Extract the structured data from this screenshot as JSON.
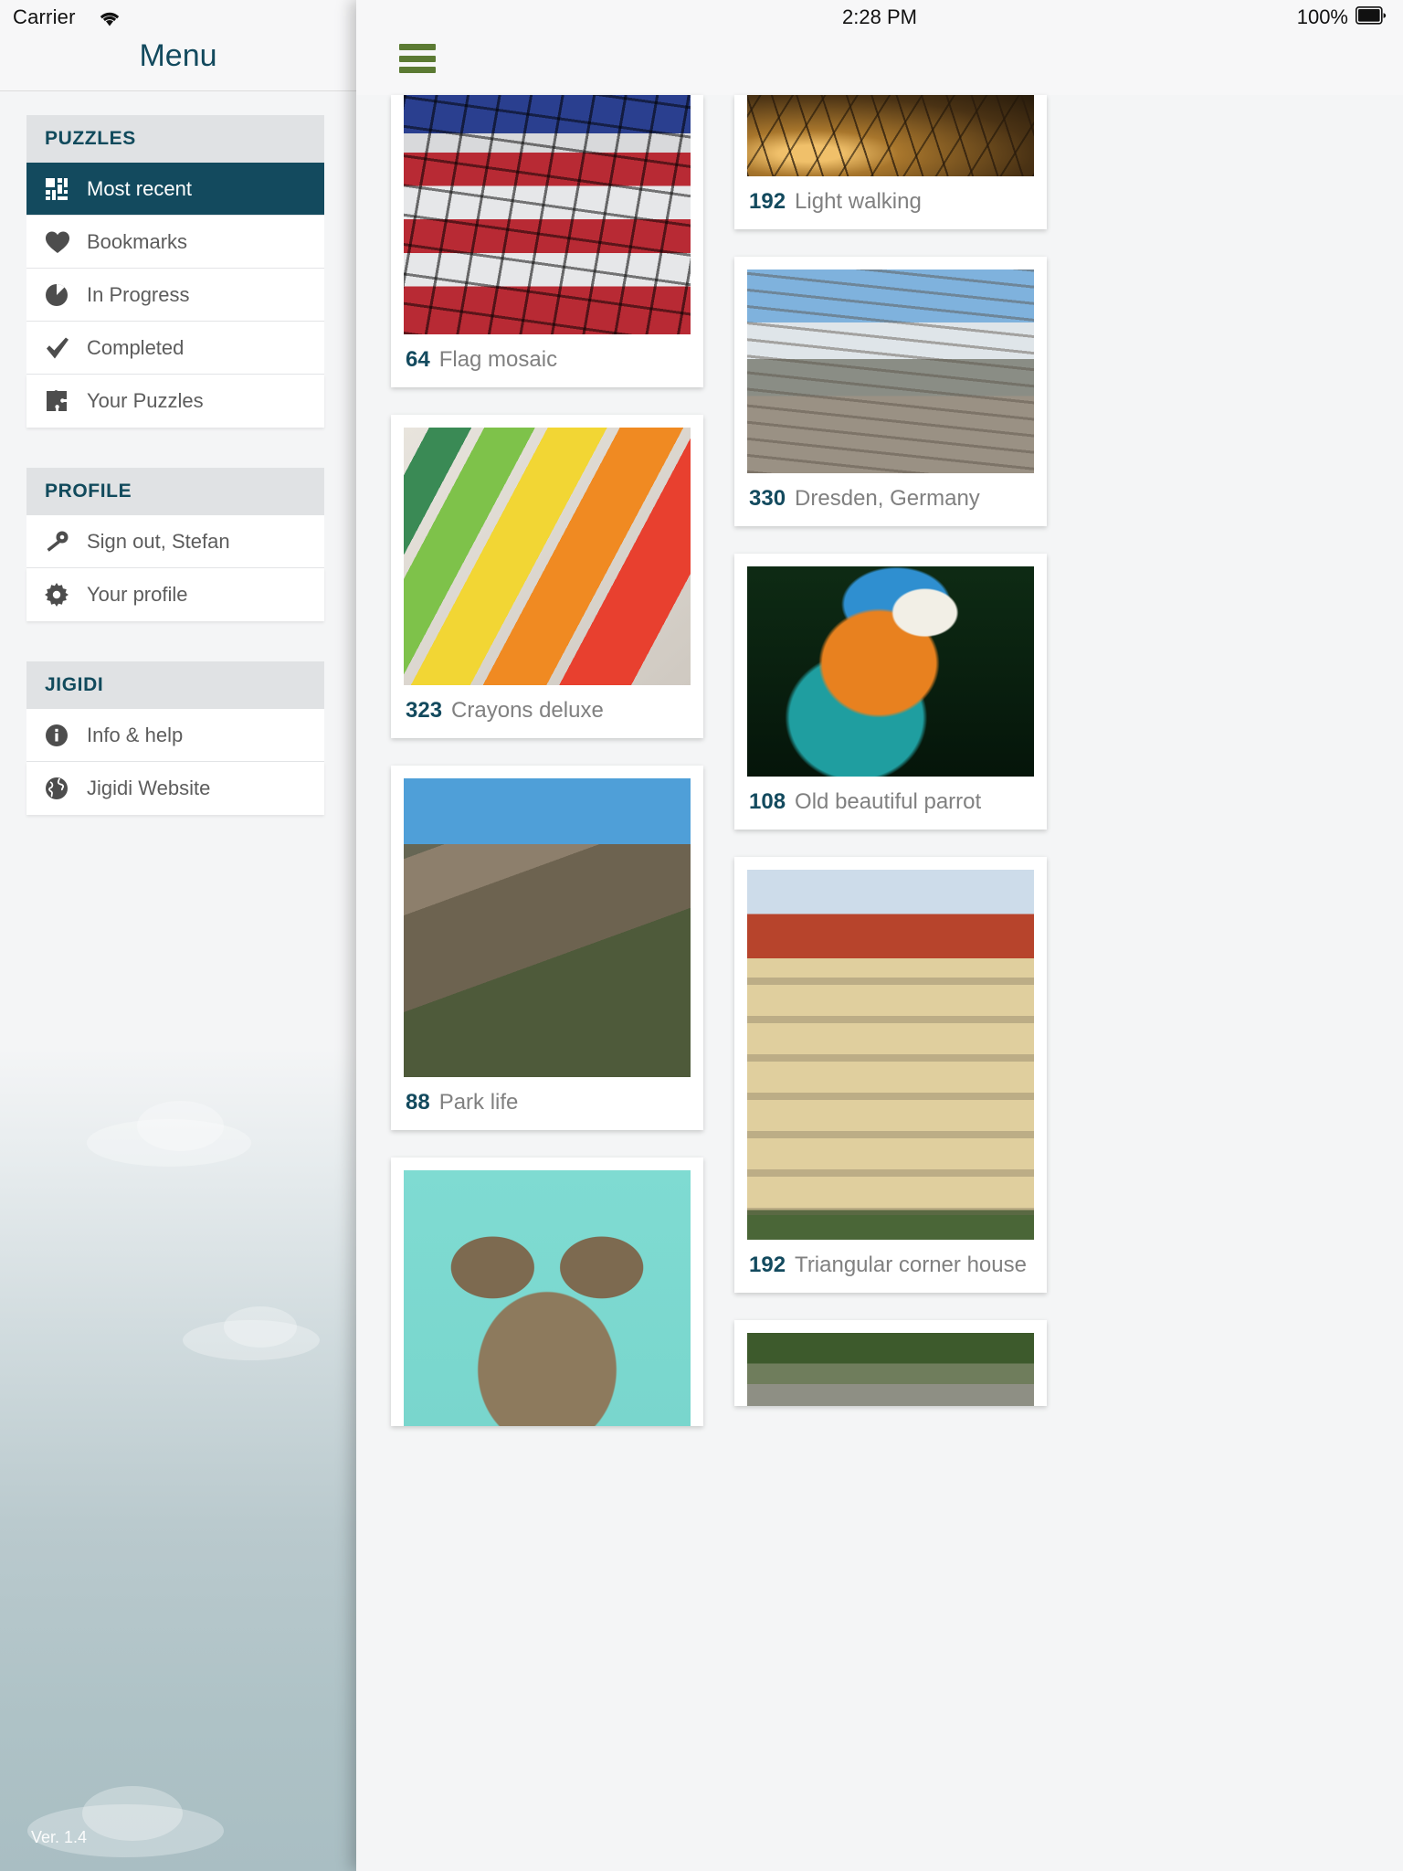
{
  "sidebar": {
    "status": {
      "carrier": "Carrier",
      "wifi_icon": "wifi-icon"
    },
    "title": "Menu",
    "version": "Ver. 1.4",
    "groups": [
      {
        "heading": "PUZZLES",
        "items": [
          {
            "label": "Most recent",
            "icon": "grid-icon",
            "active": true
          },
          {
            "label": "Bookmarks",
            "icon": "heart-icon",
            "active": false
          },
          {
            "label": "In Progress",
            "icon": "pie-icon",
            "active": false
          },
          {
            "label": "Completed",
            "icon": "check-icon",
            "active": false
          },
          {
            "label": "Your Puzzles",
            "icon": "puzzle-icon",
            "active": false
          }
        ]
      },
      {
        "heading": "PROFILE",
        "items": [
          {
            "label": "Sign out, Stefan",
            "icon": "key-icon",
            "active": false
          },
          {
            "label": "Your profile",
            "icon": "gear-icon",
            "active": false
          }
        ]
      },
      {
        "heading": "JIGIDI",
        "items": [
          {
            "label": "Info & help",
            "icon": "info-icon",
            "active": false
          },
          {
            "label": "Jigidi Website",
            "icon": "globe-icon",
            "active": false
          }
        ]
      }
    ]
  },
  "main": {
    "status": {
      "time": "2:28 PM",
      "battery_pct": "100%",
      "battery_icon": "battery-full-icon"
    },
    "menu_icon": "hamburger-icon",
    "accent_color": "#134a5e",
    "menu_icon_color": "#5b7a33",
    "cards_left": [
      {
        "pieces": "64",
        "title": "Flag mosaic",
        "clip": "top"
      },
      {
        "pieces": "323",
        "title": "Crayons deluxe",
        "clip": "none"
      },
      {
        "pieces": "88",
        "title": "Park life",
        "clip": "none"
      },
      {
        "pieces": "",
        "title": "",
        "clip": "bottom"
      }
    ],
    "cards_right": [
      {
        "pieces": "192",
        "title": "Light walking",
        "clip": "top"
      },
      {
        "pieces": "330",
        "title": "Dresden, Germany",
        "clip": "none"
      },
      {
        "pieces": "108",
        "title": "Old beautiful parrot",
        "clip": "none"
      },
      {
        "pieces": "192",
        "title": "Triangular corner house",
        "clip": "tall"
      },
      {
        "pieces": "",
        "title": "",
        "clip": "bottom"
      }
    ]
  }
}
